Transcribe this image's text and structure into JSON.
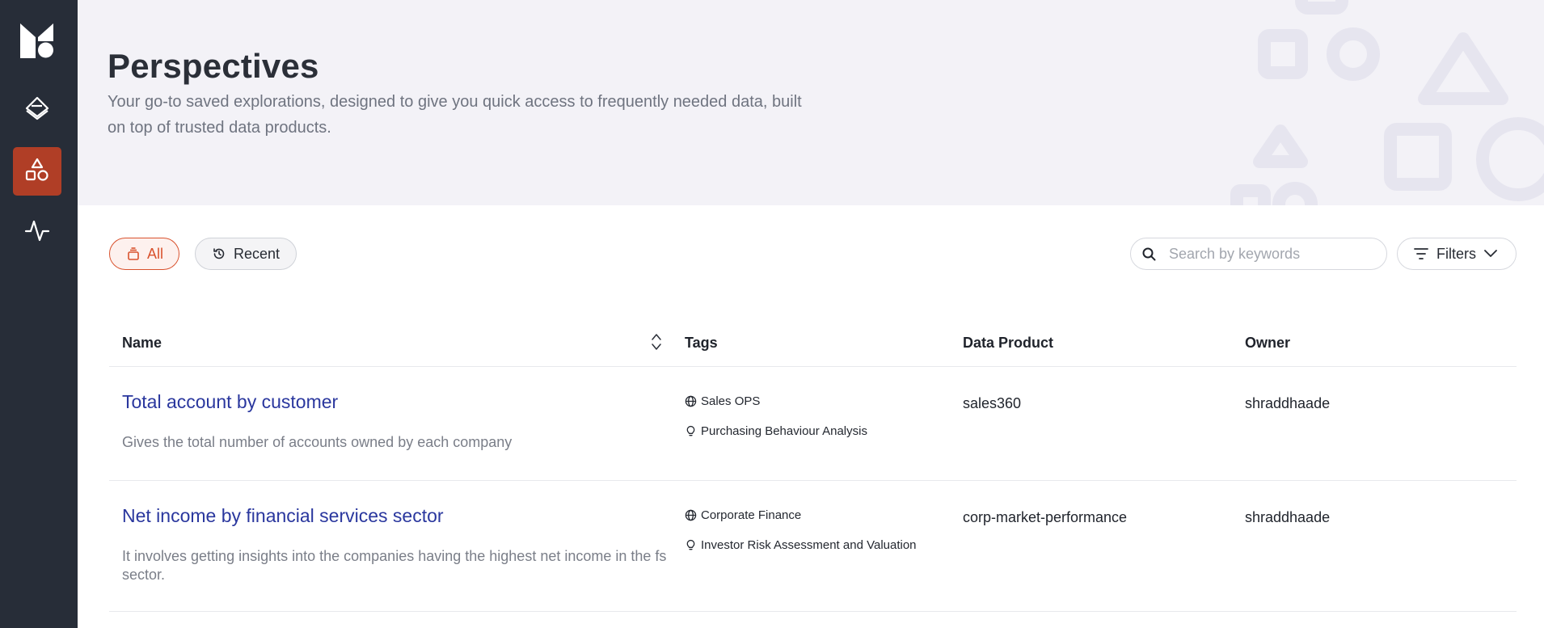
{
  "header": {
    "title": "Perspectives",
    "subtitle": "Your go-to saved explorations, designed to give you quick access to frequently needed data, built on top of trusted data products."
  },
  "sidebar": {
    "items": [
      {
        "name": "logo",
        "icon": "brand-logo"
      },
      {
        "name": "data-products",
        "icon": "layers-diamond-icon"
      },
      {
        "name": "perspectives",
        "icon": "shapes-icon",
        "active": true
      },
      {
        "name": "metrics",
        "icon": "activity-icon"
      }
    ]
  },
  "toolbar": {
    "tabs": [
      {
        "label": "All",
        "icon": "stack-icon",
        "selected": true
      },
      {
        "label": "Recent",
        "icon": "history-icon",
        "selected": false
      }
    ],
    "search_placeholder": "Search by keywords",
    "filters_label": "Filters"
  },
  "table": {
    "columns": [
      "Name",
      "Tags",
      "Data Product",
      "Owner"
    ],
    "rows": [
      {
        "name": "Total account by customer",
        "description": "Gives the total number of accounts owned by each company",
        "tags": [
          {
            "icon": "globe-icon",
            "label": "Sales OPS"
          },
          {
            "icon": "lightbulb-icon",
            "label": "Purchasing Behaviour Analysis"
          }
        ],
        "data_product": "sales360",
        "owner": "shraddhaade"
      },
      {
        "name": "Net income by financial services sector",
        "description": "It involves getting insights into the companies having the highest net income in the fs sector.",
        "tags": [
          {
            "icon": "globe-icon",
            "label": "Corporate Finance"
          },
          {
            "icon": "lightbulb-icon",
            "label": "Investor Risk Assessment and Valuation"
          }
        ],
        "data_product": "corp-market-performance",
        "owner": "shraddhaade"
      }
    ]
  },
  "colors": {
    "sidebar_bg": "#272d38",
    "active_nav": "#b03e26",
    "accent": "#d9522e",
    "link": "#2a379e",
    "hero_bg": "#f3f2f7"
  }
}
